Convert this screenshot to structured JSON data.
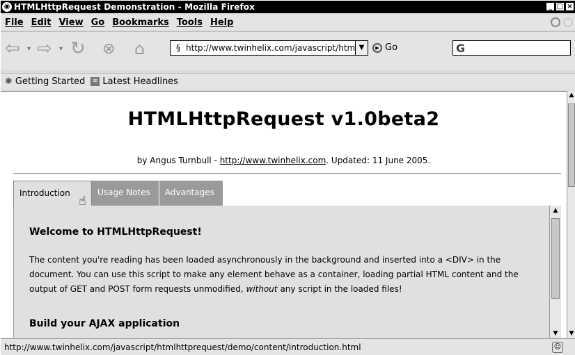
{
  "window": {
    "title": "HTMLHttpRequest Demonstration - Mozilla Firefox",
    "controls": [
      "_",
      "□",
      "×"
    ]
  },
  "menu": [
    "File",
    "Edit",
    "View",
    "Go",
    "Bookmarks",
    "Tools",
    "Help"
  ],
  "nav": {
    "url": "http://www.twinhelix.com/javascript/htmlhttp",
    "go_label": "Go",
    "search_value": ""
  },
  "bookmarks": [
    "Getting Started",
    "Latest Headlines"
  ],
  "page": {
    "title": "HTMLHttpRequest v1.0beta2",
    "byline_prefix": "by Angus Turnbull - ",
    "byline_link": "http://www.twinhelix.com",
    "byline_suffix": ". Updated: 11 June 2005.",
    "tabs": [
      "Introduction",
      "Usage Notes",
      "Advantages"
    ],
    "heading1": "Welcome to HTMLHttpRequest!",
    "para_1": "The content you're reading has been loaded asynchronously in the background and inserted into a <DIV> in the document. You can use this script to make any element behave as a container, loading partial HTML content and the output of GET and POST form requests unmodified, ",
    "para_em": "without",
    "para_2": " any script in the loaded files!",
    "heading2": "Build your AJAX application"
  },
  "status": {
    "text": "http://www.twinhelix.com/javascript/htmlhttprequest/demo/content/introduction.html"
  }
}
